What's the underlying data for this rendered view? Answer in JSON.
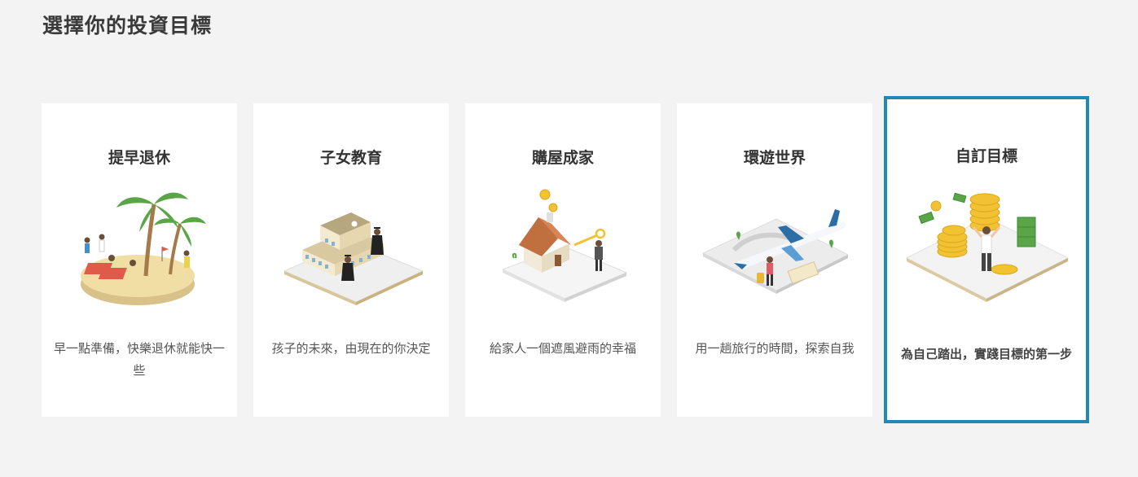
{
  "page": {
    "title": "選擇你的投資目標"
  },
  "goals": [
    {
      "title": "提早退休",
      "desc": "早一點準備，快樂退休就能快一些",
      "icon": "beach-retirement-icon",
      "selected": false
    },
    {
      "title": "子女教育",
      "desc": "孩子的未來，由現在的你決定",
      "icon": "graduation-school-icon",
      "selected": false
    },
    {
      "title": "購屋成家",
      "desc": "給家人一個遮風避雨的幸福",
      "icon": "house-key-icon",
      "selected": false
    },
    {
      "title": "環遊世界",
      "desc": "用一趟旅行的時間，探索自我",
      "icon": "airplane-travel-icon",
      "selected": false
    },
    {
      "title": "自訂目標",
      "desc": "為自己踏出，實踐目標的第一步",
      "icon": "coins-money-icon",
      "selected": true
    }
  ],
  "colors": {
    "background": "#f3f3f3",
    "card": "#ffffff",
    "selected_border": "#2287b5"
  }
}
